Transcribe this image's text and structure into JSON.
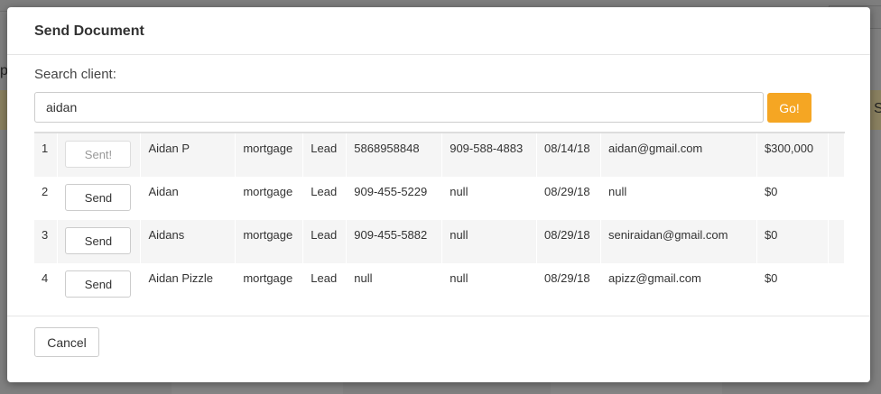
{
  "background": {
    "fragment_left": "p",
    "fragment_right": "S"
  },
  "modal": {
    "title": "Send Document",
    "search": {
      "label": "Search client:",
      "value": "aidan",
      "go_label": "Go!"
    },
    "rows": [
      {
        "num": "1",
        "action": "Sent!",
        "name": "Aidan P",
        "type": "mortgage",
        "stage": "Lead",
        "phone1": "5868958848",
        "phone2": "909-588-4883",
        "date": "08/14/18",
        "email": "aidan@gmail.com",
        "amount": "$300,000"
      },
      {
        "num": "2",
        "action": "Send",
        "name": "Aidan",
        "type": "mortgage",
        "stage": "Lead",
        "phone1": "909-455-5229",
        "phone2": "null",
        "date": "08/29/18",
        "email": "null",
        "amount": "$0"
      },
      {
        "num": "3",
        "action": "Send",
        "name": "Aidans",
        "type": "mortgage",
        "stage": "Lead",
        "phone1": "909-455-5882",
        "phone2": "null",
        "date": "08/29/18",
        "email": "seniraidan@gmail.com",
        "amount": "$0"
      },
      {
        "num": "4",
        "action": "Send",
        "name": "Aidan Pizzle",
        "type": "mortgage",
        "stage": "Lead",
        "phone1": "null",
        "phone2": "null",
        "date": "08/29/18",
        "email": "apizz@gmail.com",
        "amount": "$0"
      }
    ],
    "cancel_label": "Cancel"
  }
}
